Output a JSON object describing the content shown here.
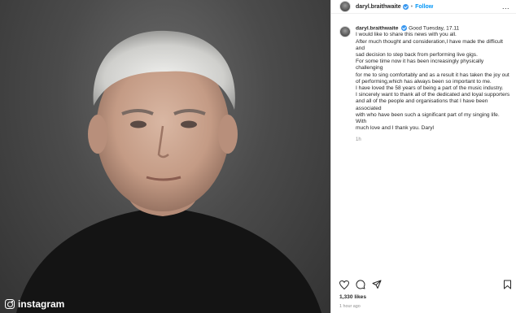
{
  "photo": {
    "description_icon": "portrait-photo",
    "watermark_label": "instagram"
  },
  "post": {
    "username": "daryl.braithwaite",
    "follow_label": "Follow",
    "header_separator": "•",
    "more_label": "...",
    "caption_lines": [
      "Good Tuesday, 17.11",
      "I would like to share this news with you all.",
      "After much thought and consideration,I have made the difficult and",
      "sad decision to step back from performing live gigs.",
      "For some time now it has been increasingly physically challenging",
      "for me to sing comfortably and as a result it has taken the joy out",
      "of performing,which has always been so important to me.",
      "I have loved the 58 years of being a part of the music industry.",
      "I sincerely want to thank all of the dedicated and loyal supporters",
      "and all of the people and organisations that I have been associated",
      "with who have been such a significant part of my singing life. With",
      "much love and I thank you. Daryl"
    ],
    "caption_age": "1h",
    "likes": "1,330 likes",
    "posted_ago": "1 hour ago"
  },
  "colors": {
    "link": "#0095f6",
    "verified": "#3897f0",
    "muted": "#8e8e8e"
  }
}
